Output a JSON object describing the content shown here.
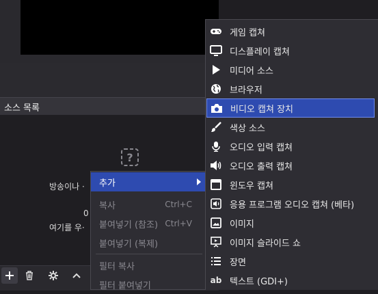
{
  "dock": {
    "title": "소스 목록",
    "empty_line1": "방송이나 ·",
    "empty_line2": "0",
    "empty_line3": "여기를 우·"
  },
  "context_menu": {
    "add": "추가",
    "copy": "복사",
    "copy_shortcut": "Ctrl+C",
    "paste_ref": "붙여넣기 (참조)",
    "paste_ref_shortcut": "Ctrl+V",
    "paste_dup": "붙여넣기 (복제)",
    "copy_filter": "필터 복사",
    "paste_filter": "필터 붙여넣기"
  },
  "add_submenu": {
    "items": [
      {
        "label": "게임 캡쳐",
        "icon": "gamepad-icon"
      },
      {
        "label": "디스플레이 캡쳐",
        "icon": "monitor-icon"
      },
      {
        "label": "미디어 소스",
        "icon": "play-icon"
      },
      {
        "label": "브라우저",
        "icon": "globe-icon"
      },
      {
        "label": "비디오 캡쳐 장치",
        "icon": "camera-icon"
      },
      {
        "label": "색상 소스",
        "icon": "brush-icon"
      },
      {
        "label": "오디오 입력 캡쳐",
        "icon": "microphone-icon"
      },
      {
        "label": "오디오 출력 캡쳐",
        "icon": "speaker-icon"
      },
      {
        "label": "윈도우 캡쳐",
        "icon": "window-icon"
      },
      {
        "label": "응용 프로그램 오디오 캡쳐 (베타)",
        "icon": "app-audio-icon"
      },
      {
        "label": "이미지",
        "icon": "image-icon"
      },
      {
        "label": "이미지 슬라이드 쇼",
        "icon": "slideshow-icon"
      },
      {
        "label": "장면",
        "icon": "list-icon"
      },
      {
        "label": "텍스트 (GDI+)",
        "icon": "text-icon"
      }
    ],
    "text_icon_glyph": "ab"
  },
  "colors": {
    "highlight": "#2e4bb0",
    "menu_bg": "#2e2d33",
    "panel_bg": "#1f1e22"
  }
}
